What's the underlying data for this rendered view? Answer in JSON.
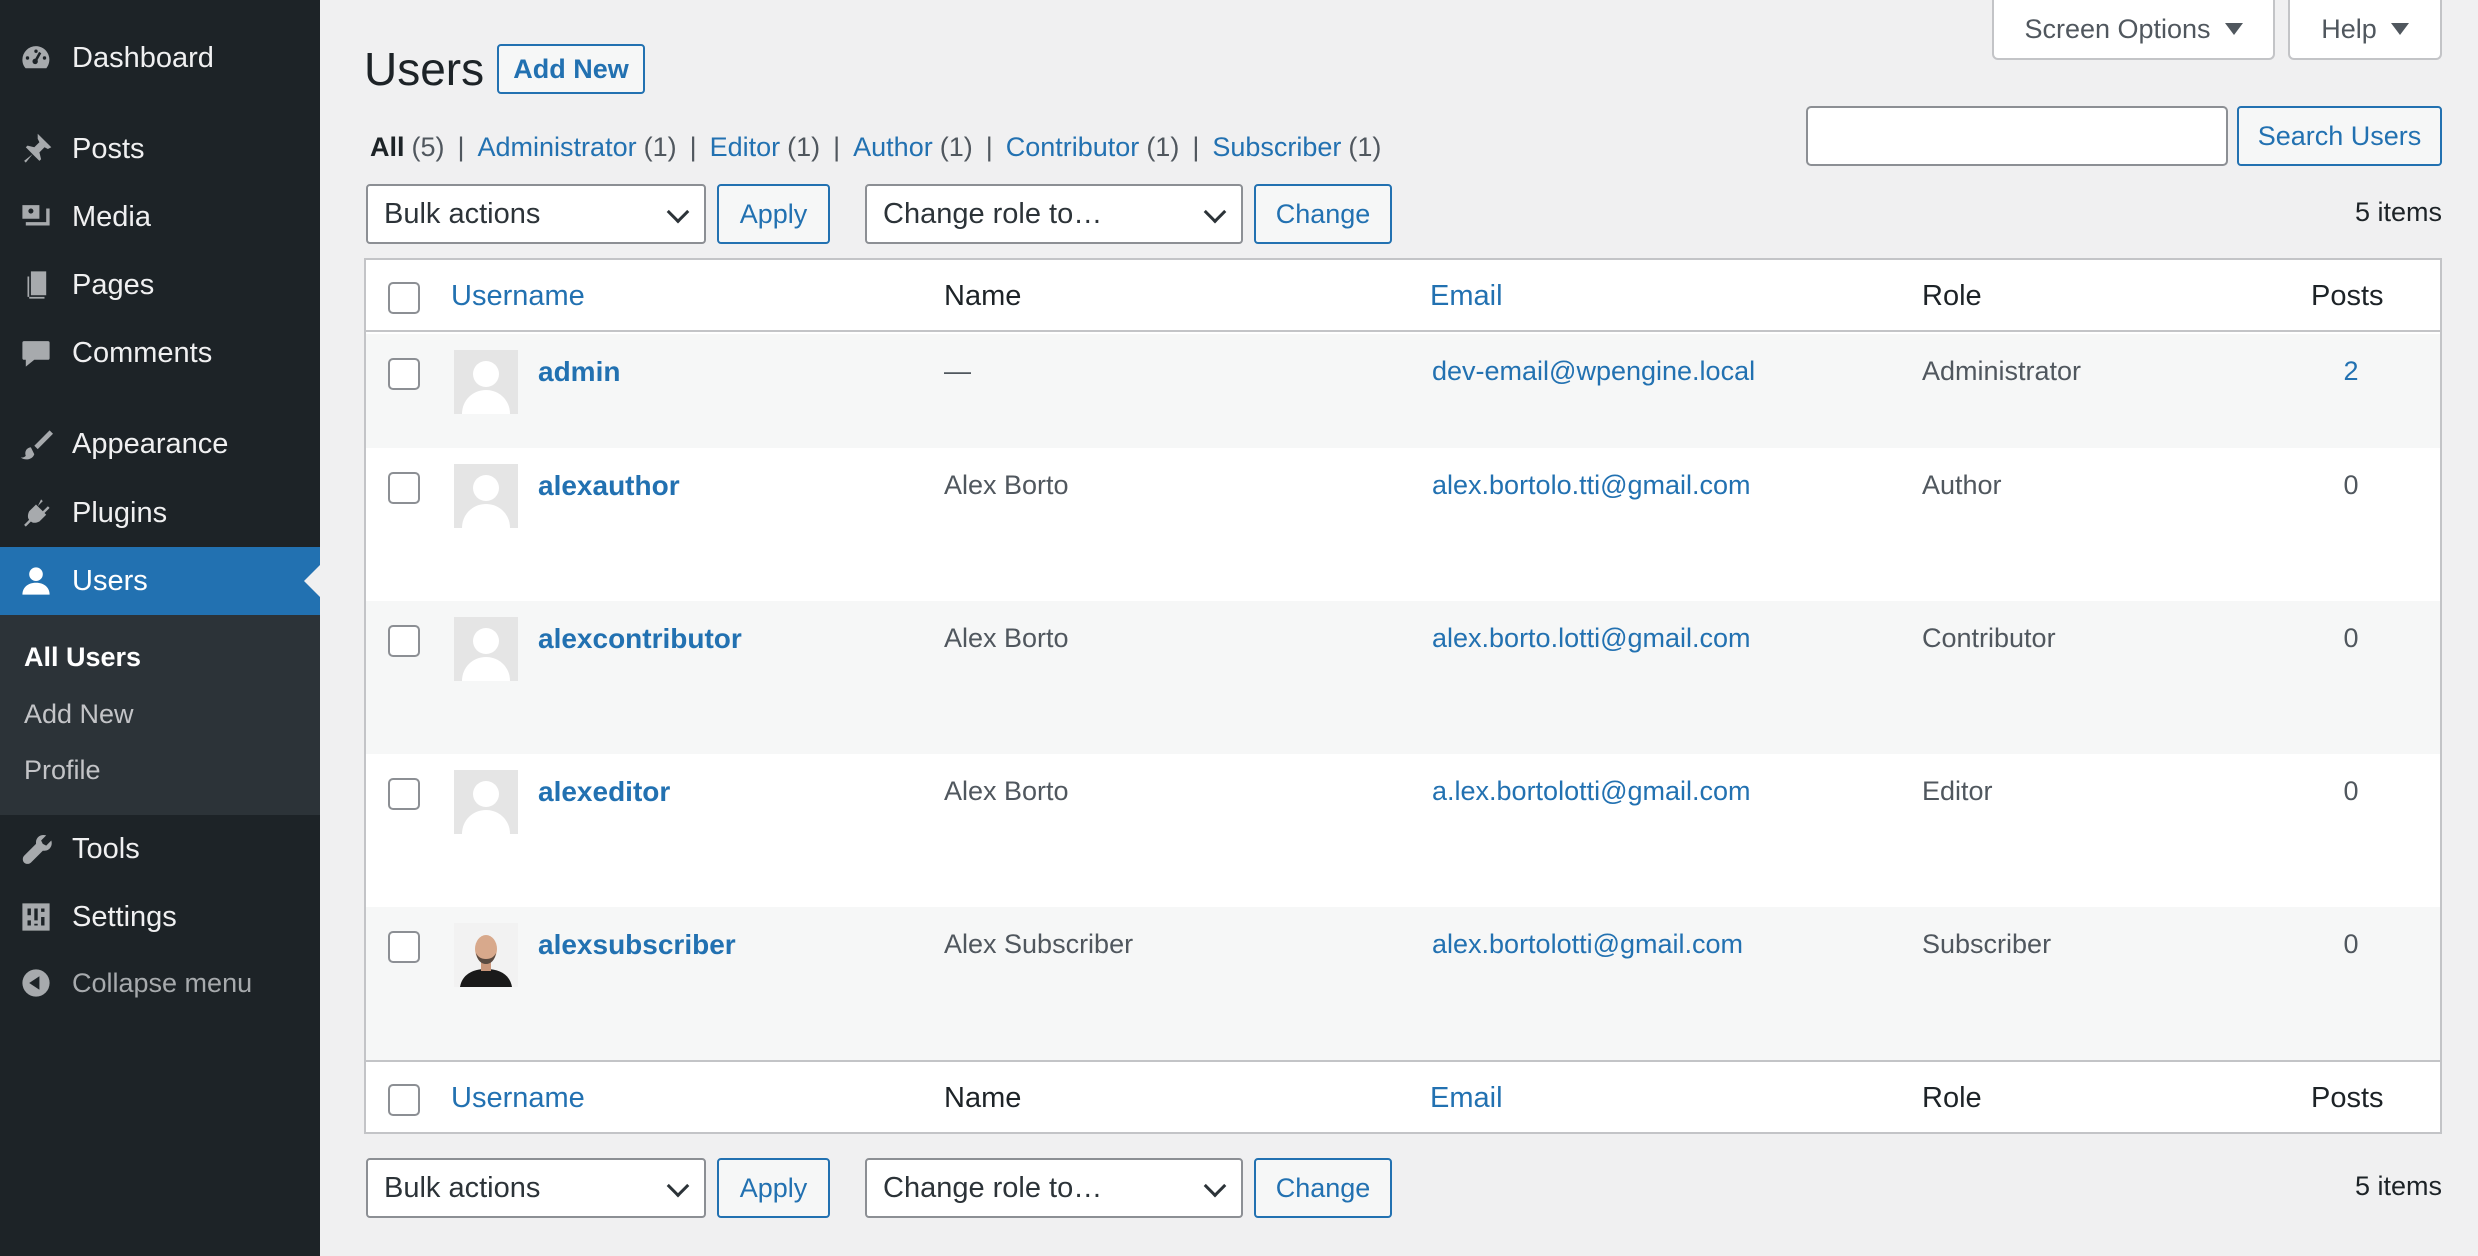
{
  "sidebar": {
    "items": [
      {
        "label": "Dashboard",
        "icon": "dashboard-icon"
      },
      {
        "label": "Posts",
        "icon": "pin-icon"
      },
      {
        "label": "Media",
        "icon": "media-icon"
      },
      {
        "label": "Pages",
        "icon": "pages-icon"
      },
      {
        "label": "Comments",
        "icon": "comment-icon"
      },
      {
        "label": "Appearance",
        "icon": "paintbrush-icon"
      },
      {
        "label": "Plugins",
        "icon": "plugin-icon"
      },
      {
        "label": "Users",
        "icon": "users-icon",
        "active": true
      },
      {
        "label": "Tools",
        "icon": "wrench-icon"
      },
      {
        "label": "Settings",
        "icon": "settings-icon"
      },
      {
        "label": "Collapse menu",
        "icon": "collapse-icon"
      }
    ],
    "submenu": [
      {
        "label": "All Users",
        "current": true
      },
      {
        "label": "Add New"
      },
      {
        "label": "Profile"
      }
    ]
  },
  "header": {
    "title": "Users",
    "add_new": "Add New",
    "screen_options": "Screen Options",
    "help": "Help"
  },
  "search": {
    "value": "",
    "button": "Search Users"
  },
  "filters": [
    {
      "label": "All",
      "count": "(5)",
      "current": true
    },
    {
      "label": "Administrator",
      "count": "(1)"
    },
    {
      "label": "Editor",
      "count": "(1)"
    },
    {
      "label": "Author",
      "count": "(1)"
    },
    {
      "label": "Contributor",
      "count": "(1)"
    },
    {
      "label": "Subscriber",
      "count": "(1)"
    }
  ],
  "tablenav": {
    "bulk_actions": "Bulk actions",
    "apply": "Apply",
    "change_role": "Change role to…",
    "change": "Change",
    "items_count": "5 items"
  },
  "table": {
    "columns": {
      "username": "Username",
      "name": "Name",
      "email": "Email",
      "role": "Role",
      "posts": "Posts"
    },
    "rows": [
      {
        "username": "admin",
        "name": "—",
        "email": "dev-email@wpengine.local",
        "role": "Administrator",
        "posts": "2"
      },
      {
        "username": "alexauthor",
        "name": "Alex Borto",
        "email": "alex.bortolo.tti@gmail.com",
        "role": "Author",
        "posts": "0"
      },
      {
        "username": "alexcontributor",
        "name": "Alex Borto",
        "email": "alex.borto.lotti@gmail.com",
        "role": "Contributor",
        "posts": "0"
      },
      {
        "username": "alexeditor",
        "name": "Alex Borto",
        "email": "a.lex.bortolotti@gmail.com",
        "role": "Editor",
        "posts": "0"
      },
      {
        "username": "alexsubscriber",
        "name": "Alex Subscriber",
        "email": "alex.bortolotti@gmail.com",
        "role": "Subscriber",
        "posts": "0"
      }
    ]
  },
  "colors": {
    "sidebar_bg": "#1d2327",
    "accent": "#2271b1",
    "page_bg": "#f0f0f1"
  }
}
